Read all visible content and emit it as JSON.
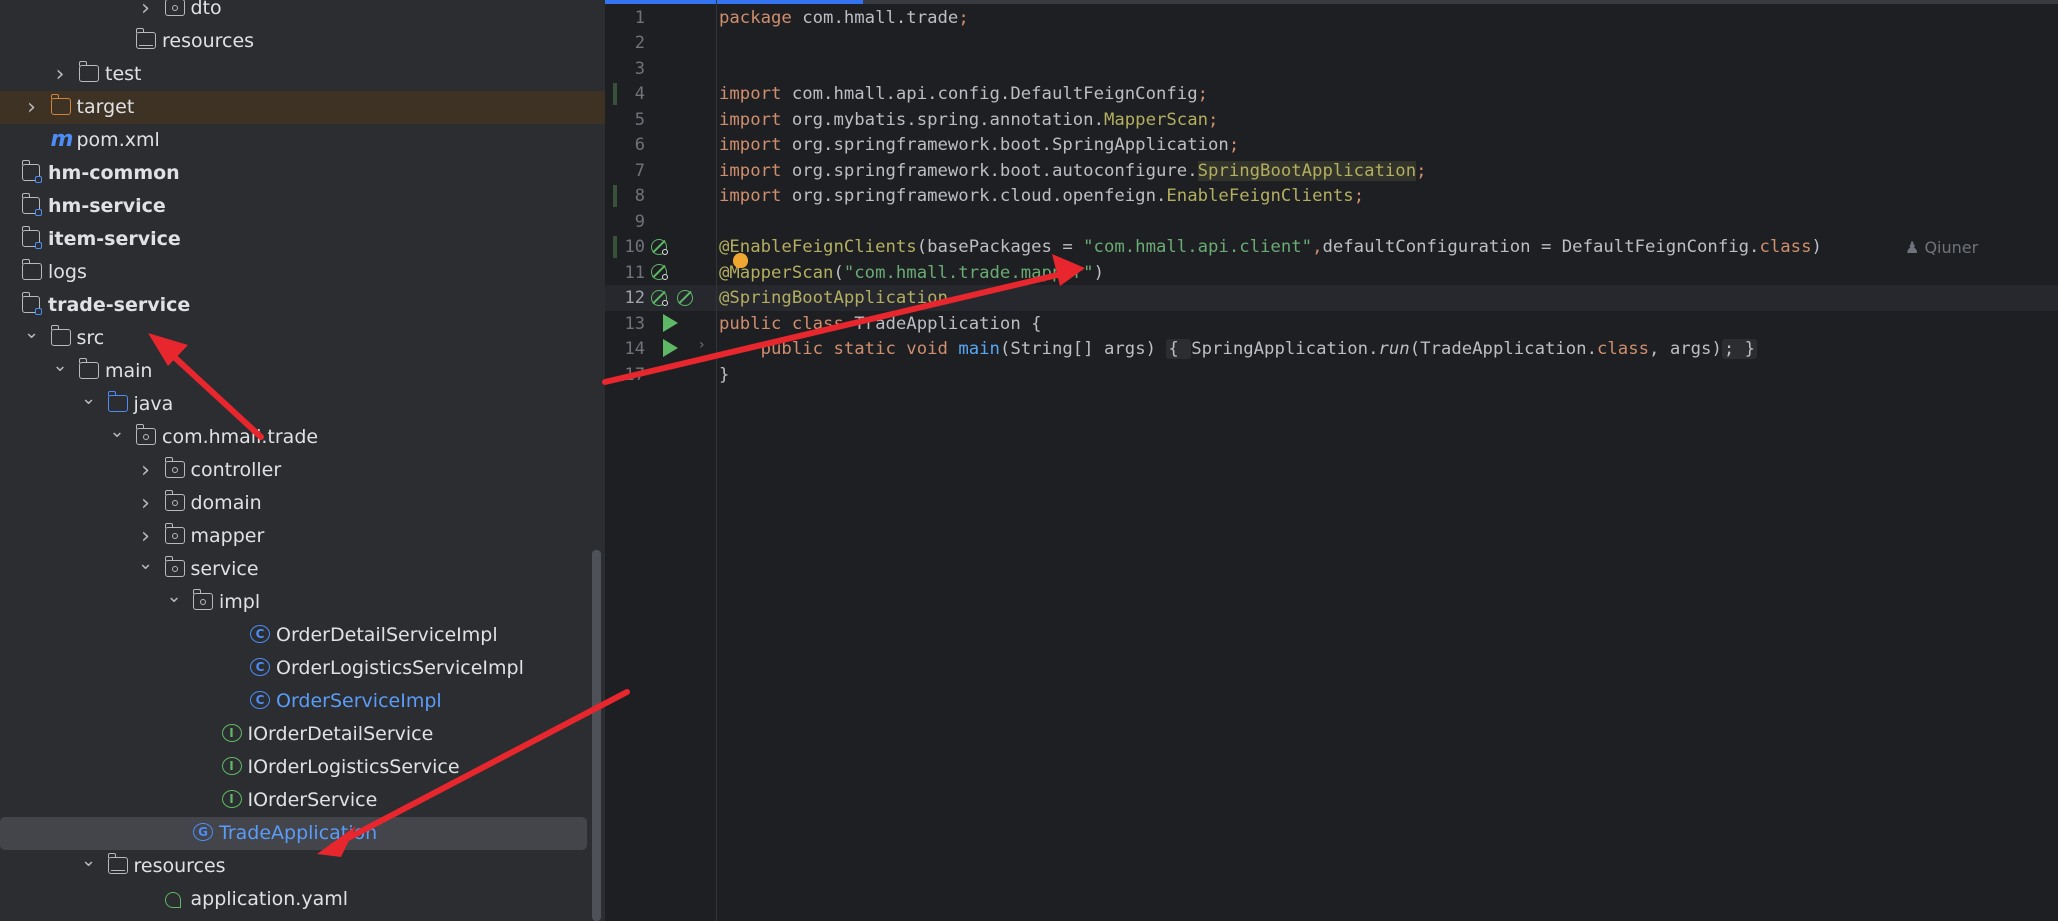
{
  "project_tree": {
    "rows": [
      {
        "label": "dto",
        "indent": 5,
        "arrow": "right",
        "icon": "package-folder-icon"
      },
      {
        "label": "resources",
        "indent": 4,
        "arrow": "",
        "icon": "resources-folder-icon"
      },
      {
        "label": "test",
        "indent": 2,
        "arrow": "right",
        "icon": "folder-icon"
      },
      {
        "label": "target",
        "indent": 1,
        "arrow": "right",
        "icon": "target-folder-icon"
      },
      {
        "label": "pom.xml",
        "indent": 1,
        "arrow": "",
        "icon": "maven-icon"
      },
      {
        "label": "hm-common",
        "indent": 0,
        "arrow": "",
        "icon": "module-icon",
        "bold": true
      },
      {
        "label": "hm-service",
        "indent": 0,
        "arrow": "",
        "icon": "module-icon",
        "bold": true
      },
      {
        "label": "item-service",
        "indent": 0,
        "arrow": "",
        "icon": "module-icon",
        "bold": true
      },
      {
        "label": "logs",
        "indent": 0,
        "arrow": "",
        "icon": "folder-icon"
      },
      {
        "label": "trade-service",
        "indent": 0,
        "arrow": "",
        "icon": "module-icon",
        "bold": true
      },
      {
        "label": "src",
        "indent": 1,
        "arrow": "down",
        "icon": "folder-icon"
      },
      {
        "label": "main",
        "indent": 2,
        "arrow": "down",
        "icon": "folder-icon"
      },
      {
        "label": "java",
        "indent": 3,
        "arrow": "down",
        "icon": "java-folder-icon"
      },
      {
        "label": "com.hmall.trade",
        "indent": 4,
        "arrow": "down",
        "icon": "package-folder-icon"
      },
      {
        "label": "controller",
        "indent": 5,
        "arrow": "right",
        "icon": "package-folder-icon"
      },
      {
        "label": "domain",
        "indent": 5,
        "arrow": "right",
        "icon": "package-folder-icon"
      },
      {
        "label": "mapper",
        "indent": 5,
        "arrow": "right",
        "icon": "package-folder-icon"
      },
      {
        "label": "service",
        "indent": 5,
        "arrow": "down",
        "icon": "package-folder-icon"
      },
      {
        "label": "impl",
        "indent": 6,
        "arrow": "down",
        "icon": "package-folder-icon"
      },
      {
        "label": "OrderDetailServiceImpl",
        "indent": 8,
        "arrow": "",
        "icon": "class-icon"
      },
      {
        "label": "OrderLogisticsServiceImpl",
        "indent": 8,
        "arrow": "",
        "icon": "class-icon"
      },
      {
        "label": "OrderServiceImpl",
        "indent": 8,
        "arrow": "",
        "icon": "class-icon",
        "blue": true
      },
      {
        "label": "IOrderDetailService",
        "indent": 7,
        "arrow": "",
        "icon": "interface-icon"
      },
      {
        "label": "IOrderLogisticsService",
        "indent": 7,
        "arrow": "",
        "icon": "interface-icon"
      },
      {
        "label": "IOrderService",
        "indent": 7,
        "arrow": "",
        "icon": "interface-icon"
      },
      {
        "label": "TradeApplication",
        "indent": 6,
        "arrow": "",
        "icon": "spring-boot-class-icon",
        "blue": true,
        "selected": true
      },
      {
        "label": "resources",
        "indent": 3,
        "arrow": "down",
        "icon": "resources-folder-icon"
      },
      {
        "label": "application.yaml",
        "indent": 5,
        "arrow": "",
        "icon": "yaml-icon"
      }
    ]
  },
  "editor": {
    "line_numbers": [
      "1",
      "2",
      "3",
      "4",
      "5",
      "6",
      "7",
      "8",
      "9",
      "10",
      "11",
      "12",
      "13",
      "14",
      "17"
    ],
    "author_hint": "Qiuner",
    "lines": {
      "l1_kw": "package",
      "l1_rest": " com.hmall.trade",
      "l1_semi": ";",
      "l4_kw": "import",
      "l4_rest": " com.hmall.api.config.DefaultFeignConfig",
      "l5_kw": "import",
      "l5_rest": " org.mybatis.spring.annotation.",
      "l5_ann": "MapperScan",
      "l6_kw": "import",
      "l6_rest": " org.springframework.boot.SpringApplication",
      "l7_kw": "import",
      "l7_rest": " org.springframework.boot.autoconfigure.",
      "l7_ann": "SpringBootApplication",
      "l8_kw": "import",
      "l8_rest": " org.springframework.cloud.openfeign.",
      "l8_ann": "EnableFeignClients",
      "semi": ";",
      "l10_ann": "@EnableFeignClients",
      "l10_a": "(basePackages = ",
      "l10_str": "\"com.hmall.api.client\"",
      "l10_comma": ",",
      "l10_b": "defaultConfiguration = DefaultFeignConfig.",
      "l10_class": "class",
      "l10_close": ")",
      "l11_ann": "@MapperScan",
      "l11_open": "(",
      "l11_str": "\"com.hmall.trade.mapper\"",
      "l11_close": ")",
      "l12_ann": "@SpringBootApplication",
      "l13_kw": "public class",
      "l13_rest": " TradeApplication {",
      "l14_kw": "public static void",
      "l14_fn": "main",
      "l14_args": "(String[] args) ",
      "l14_fold_open": "{ ",
      "l14_body": "SpringApplication.",
      "l14_run": "run",
      "l14_body2": "(TradeApplication.",
      "l14_class": "class",
      "l14_body3": ", args)",
      "l14_fold_close": "; }",
      "l17": "}"
    }
  },
  "colors": {
    "arrow": "#e8262d",
    "keyword": "#cf8e6d",
    "annotation": "#b3ae60",
    "string": "#6aab73",
    "selected_text": "#5a9cf8"
  }
}
